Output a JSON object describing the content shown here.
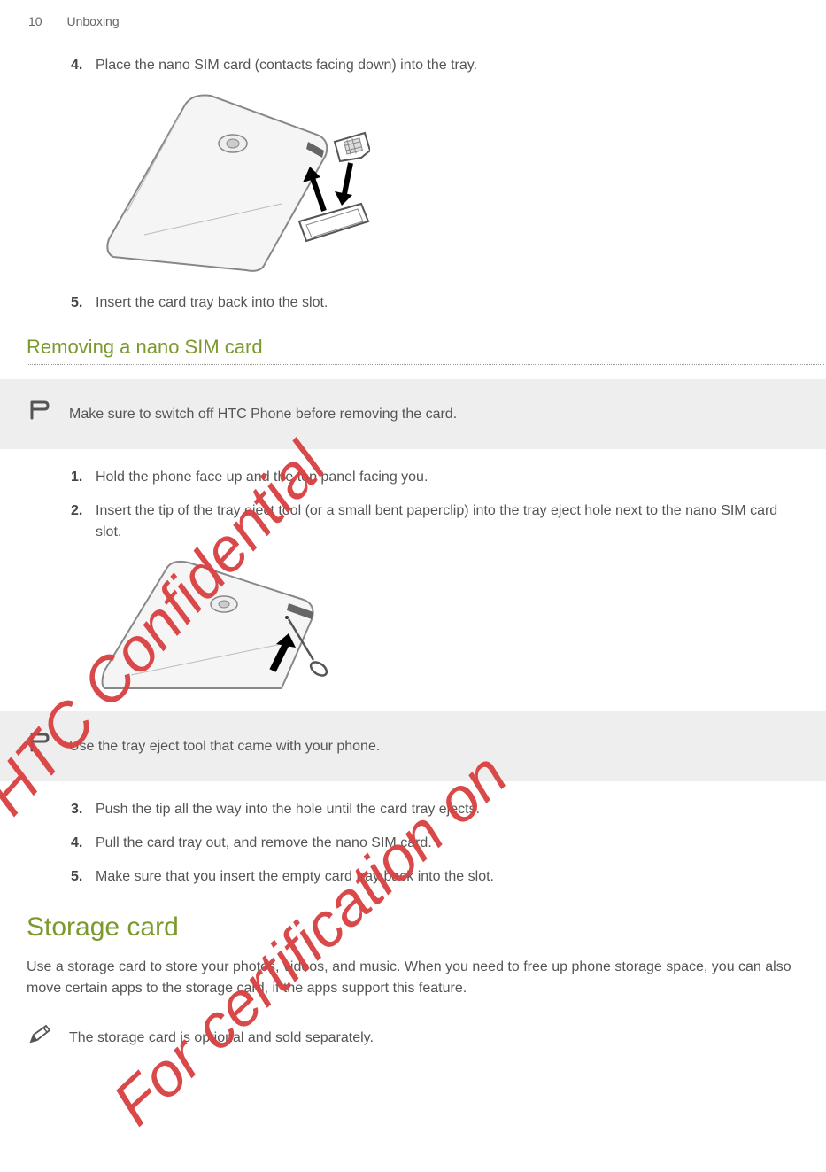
{
  "header": {
    "page_number": "10",
    "chapter": "Unboxing"
  },
  "steps_a": [
    {
      "num": "4.",
      "text": "Place the nano SIM card (contacts facing down) into the tray."
    },
    {
      "num": "5.",
      "text": "Insert the card tray back into the slot."
    }
  ],
  "section_sub": "Removing a nano SIM card",
  "callout1": "Make sure to switch off HTC Phone before removing the card.",
  "steps_b": [
    {
      "num": "1.",
      "text": "Hold the phone face up and the top panel facing you."
    },
    {
      "num": "2.",
      "text": "Insert the tip of the tray eject tool (or a small bent paperclip) into the tray eject hole next to the nano SIM card slot."
    }
  ],
  "callout2": "Use the tray eject tool that came with your phone.",
  "steps_c": [
    {
      "num": "3.",
      "text": "Push the tip all the way into the hole until the card tray ejects."
    },
    {
      "num": "4.",
      "text": "Pull the card tray out, and remove the nano SIM card."
    },
    {
      "num": "5.",
      "text": "Make sure that you insert the empty card tray back into the slot."
    }
  ],
  "section_h1": "Storage card",
  "body": "Use a storage card to store your photos, videos, and music. When you need to free up phone storage space, you can also move certain apps to the storage card, if the apps support this feature.",
  "note": "The storage card is optional and sold separately.",
  "watermark1": "HTC Confidential",
  "watermark2": "For certification on"
}
